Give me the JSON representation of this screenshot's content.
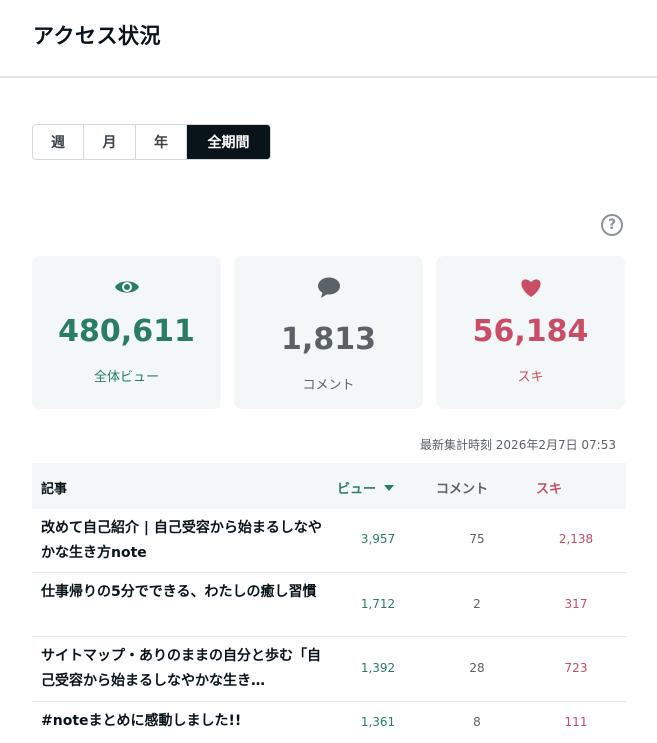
{
  "header": {
    "title": "アクセス状況"
  },
  "period_tabs": [
    {
      "label": "週",
      "active": false
    },
    {
      "label": "月",
      "active": false
    },
    {
      "label": "年",
      "active": false
    },
    {
      "label": "全期間",
      "active": true
    }
  ],
  "help_icon": {
    "glyph": "?"
  },
  "stats": {
    "views": {
      "value": "480,611",
      "label": "全体ビュー",
      "icon": "eye-icon",
      "color": "#2a7c65"
    },
    "comments": {
      "value": "1,813",
      "label": "コメント",
      "icon": "comment-bubble-icon",
      "color": "#5a6167"
    },
    "likes": {
      "value": "56,184",
      "label": "スキ",
      "icon": "heart-icon",
      "color": "#c94d67"
    }
  },
  "updated_at": "最新集計時刻 2026年2月7日 07:53",
  "table": {
    "headers": {
      "article": "記事",
      "views": "ビュー",
      "comments": "コメント",
      "likes": "スキ"
    },
    "rows": [
      {
        "title": "改めて自己紹介 | 自己受容から始まるしなやかな生き方note",
        "views": "3,957",
        "comments": "75",
        "likes": "2,138"
      },
      {
        "title": "仕事帰りの5分でできる、わたしの癒し習慣",
        "views": "1,712",
        "comments": "2",
        "likes": "317"
      },
      {
        "title": "サイトマップ・ありのままの自分と歩む「自己受容から始まるしなやかな生き…",
        "views": "1,392",
        "comments": "28",
        "likes": "723"
      },
      {
        "title": "#noteまとめに感動しました!!",
        "views": "1,361",
        "comments": "8",
        "likes": "111"
      }
    ]
  }
}
